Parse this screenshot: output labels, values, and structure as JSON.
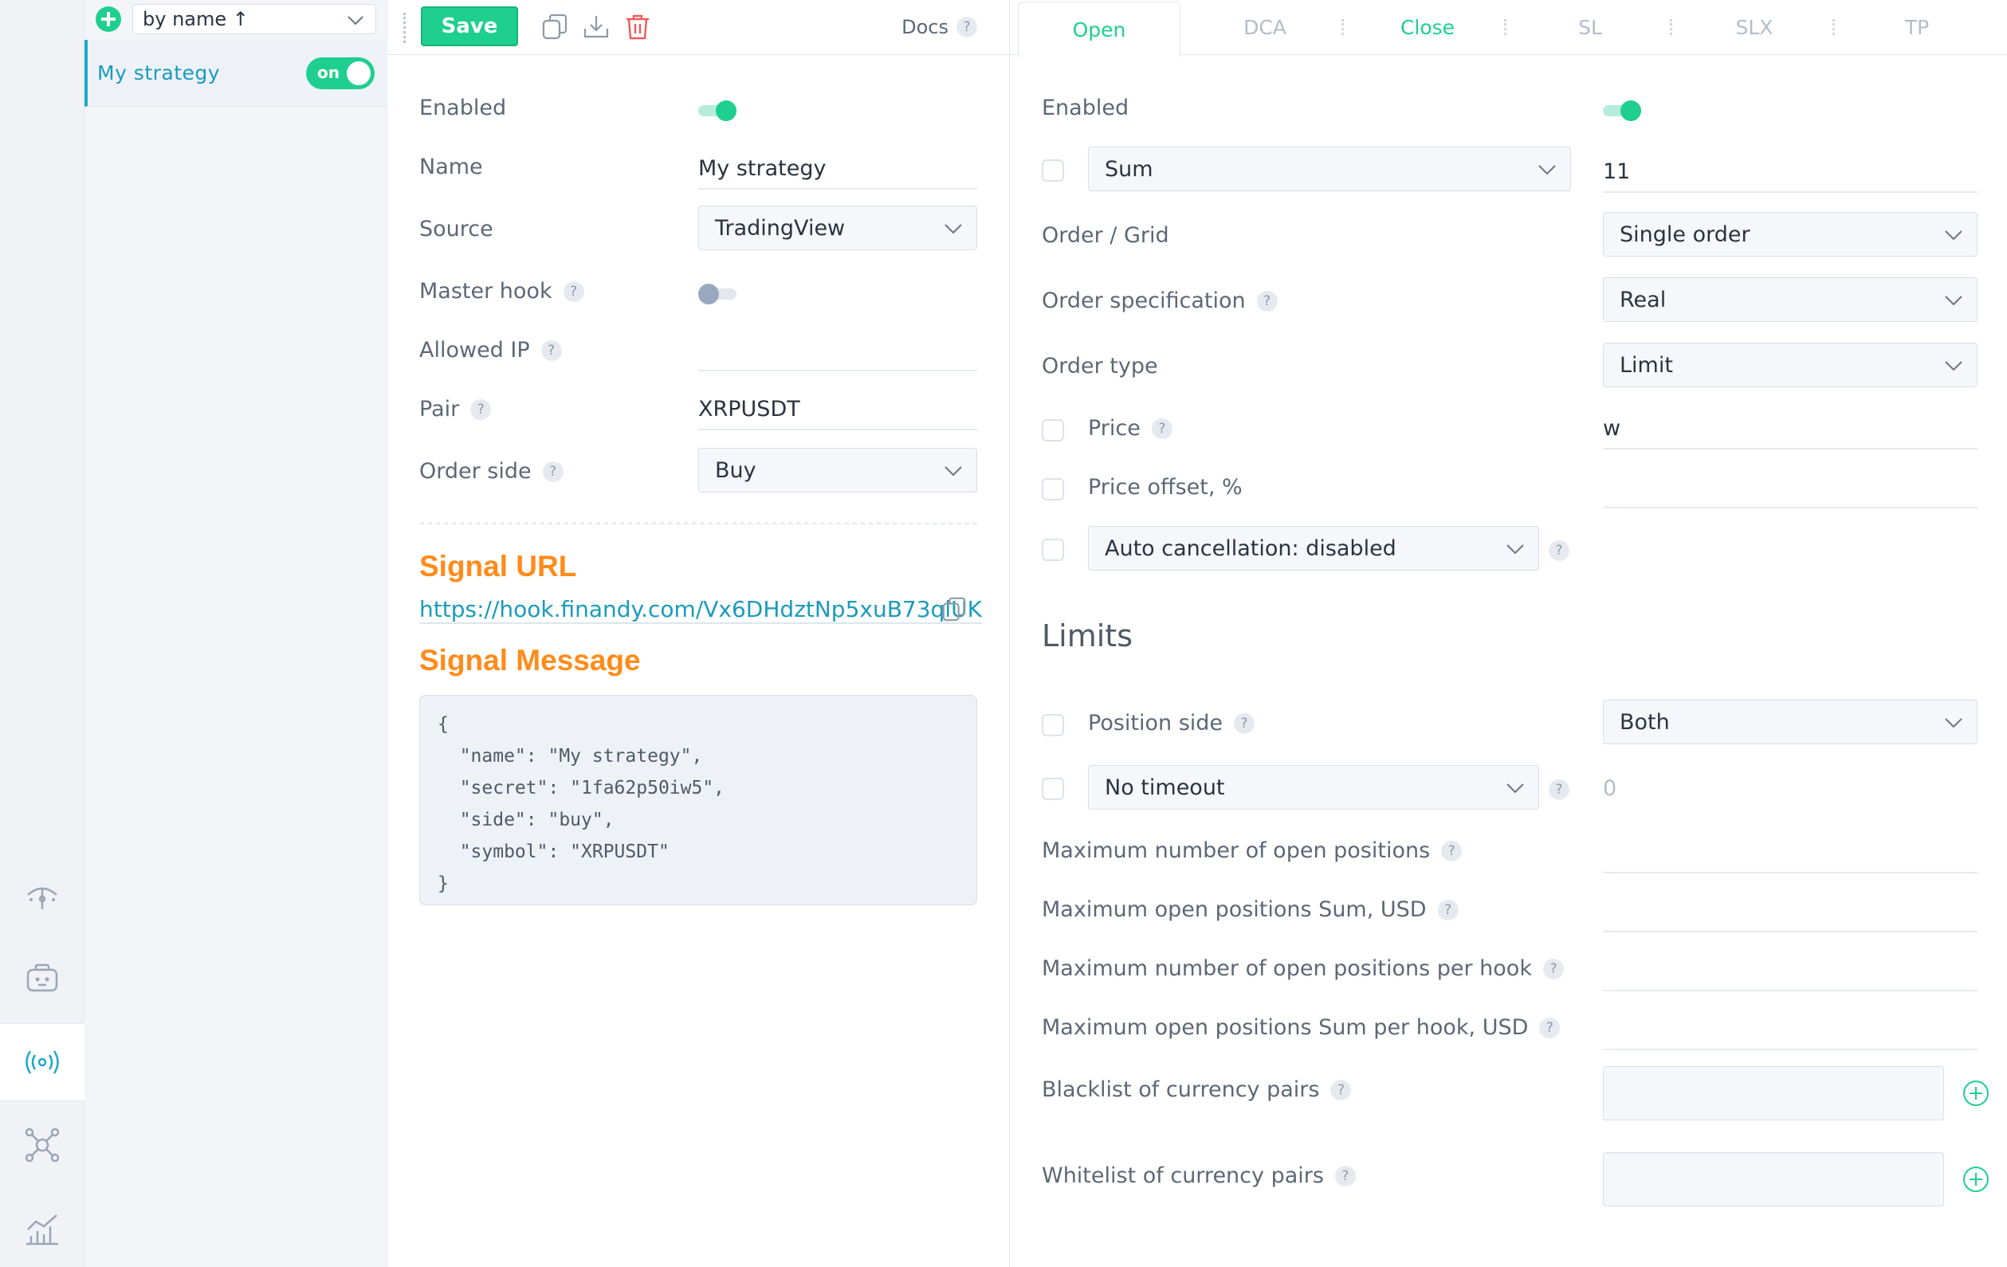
{
  "sidebar": {
    "icons": [
      "signal-tower-icon",
      "robot-icon",
      "broadcast-icon",
      "network-icon",
      "chart-icon"
    ]
  },
  "list": {
    "sort_label": "by name ↑",
    "items": [
      {
        "label": "My strategy",
        "toggle_label": "on"
      }
    ]
  },
  "toolbar": {
    "save_label": "Save",
    "docs_label": "Docs",
    "help_glyph": "?"
  },
  "settings": {
    "enabled_label": "Enabled",
    "name_label": "Name",
    "name_value": "My strategy",
    "source_label": "Source",
    "source_value": "TradingView",
    "master_hook_label": "Master hook",
    "allowed_ip_label": "Allowed IP",
    "allowed_ip_value": "",
    "pair_label": "Pair",
    "pair_value": "XRPUSDT",
    "order_side_label": "Order side",
    "order_side_value": "Buy",
    "signal_url_title": "Signal URL",
    "signal_url": "https://hook.finandy.com/Vx6DHdztNp5xuB73qlUK",
    "signal_message_title": "Signal Message",
    "signal_message": "{\n  \"name\": \"My strategy\",\n  \"secret\": \"1fa62p50iw5\",\n  \"side\": \"buy\",\n  \"symbol\": \"XRPUSDT\"\n}"
  },
  "tabs": [
    "Open",
    "DCA",
    "Close",
    "SL",
    "SLX",
    "TP"
  ],
  "open": {
    "enabled_label": "Enabled",
    "sum_select": "Sum",
    "sum_value": "11",
    "order_grid_label": "Order / Grid",
    "order_grid_value": "Single order",
    "order_spec_label": "Order specification",
    "order_spec_value": "Real",
    "order_type_label": "Order type",
    "order_type_value": "Limit",
    "price_label": "Price",
    "price_value": "w",
    "price_offset_label": "Price offset, %",
    "price_offset_value": "",
    "auto_cancel_value": "Auto cancellation: disabled"
  },
  "limits": {
    "title": "Limits",
    "position_side_label": "Position side",
    "position_side_value": "Both",
    "timeout_value": "No timeout",
    "timeout_number": "0",
    "max_open_positions_label": "Maximum number of open positions",
    "max_open_sum_label": "Maximum open positions Sum, USD",
    "max_open_per_hook_label": "Maximum number of open positions per hook",
    "max_open_sum_per_hook_label": "Maximum open positions Sum per hook, USD",
    "blacklist_label": "Blacklist of currency pairs",
    "whitelist_label": "Whitelist of currency pairs"
  },
  "colors": {
    "accent_green": "#1fcf8f",
    "link_blue": "#1a9bbd",
    "title_orange": "#ff8b1a",
    "delete_red": "#f05a5a"
  }
}
